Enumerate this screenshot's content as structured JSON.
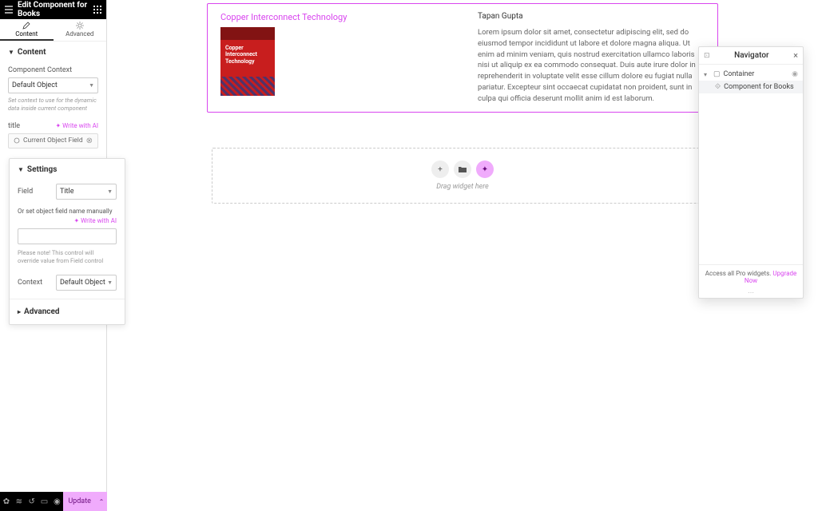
{
  "header": {
    "title": "Edit Component for Books"
  },
  "tabs": {
    "content": "Content",
    "advanced": "Advanced"
  },
  "content_section": {
    "title": "Content",
    "context_label": "Component Context",
    "context_value": "Default Object",
    "context_help": "Set context to use for the dynamic data inside current component"
  },
  "title_field": {
    "label": "title",
    "ai": "✦ Write with AI",
    "dyn_value": "Current Object Field"
  },
  "popup": {
    "settings": "Settings",
    "field_label": "Field",
    "field_value": "Title",
    "manual_label": "Or set object field name manually",
    "ai": "✦ Write with AI",
    "note": "Please note! This control will override value from Field control",
    "context_label": "Context",
    "context_value": "Default Object",
    "advanced": "Advanced"
  },
  "bottom": {
    "update": "Update"
  },
  "card": {
    "title": "Copper Interconnect Technology",
    "cover_text": "Copper Interconnect Technology",
    "author": "Tapan Gupta",
    "lorem": "Lorem ipsum dolor sit amet, consectetur adipiscing elit, sed do eiusmod tempor incididunt ut labore et dolore magna aliqua. Ut enim ad minim veniam, quis nostrud exercitation ullamco laboris nisi ut aliquip ex ea commodo consequat. Duis aute irure dolor in reprehenderit in voluptate velit esse cillum dolore eu fugiat nulla pariatur. Excepteur sint occaecat cupidatat non proident, sunt in culpa qui officia deserunt mollit anim id est laborum."
  },
  "dropzone": {
    "text": "Drag widget here"
  },
  "navigator": {
    "title": "Navigator",
    "container": "Container",
    "component": "Component for Books",
    "footer_pre": "Access all Pro widgets.",
    "footer_link": "Upgrade Now"
  }
}
